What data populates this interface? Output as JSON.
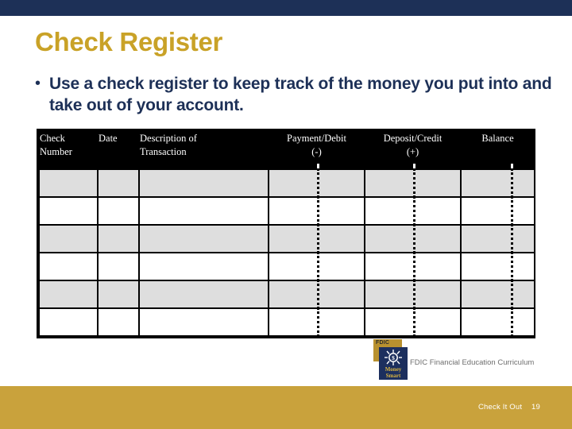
{
  "slide": {
    "title": "Check Register",
    "bullets": [
      {
        "marker": "•",
        "text": "Use a check register to keep track of the money you put into and take out of your account."
      }
    ]
  },
  "register": {
    "columns": [
      {
        "line1": "Check",
        "line2": "Number",
        "align": "left",
        "money": false
      },
      {
        "line1": "Date",
        "line2": "",
        "align": "left",
        "money": false
      },
      {
        "line1": "Description of",
        "line2": "Transaction",
        "align": "left",
        "money": false
      },
      {
        "line1": "Payment/Debit",
        "line2": "(-)",
        "align": "center",
        "money": true
      },
      {
        "line1": "Deposit/Credit",
        "line2": "(+)",
        "align": "center",
        "money": true
      },
      {
        "line1": "Balance",
        "line2": "",
        "align": "center",
        "money": true
      }
    ],
    "row_count": 6,
    "rows": [
      {
        "shaded": true,
        "cells": [
          "",
          "",
          "",
          "",
          "",
          ""
        ]
      },
      {
        "shaded": false,
        "cells": [
          "",
          "",
          "",
          "",
          "",
          ""
        ]
      },
      {
        "shaded": true,
        "cells": [
          "",
          "",
          "",
          "",
          "",
          ""
        ]
      },
      {
        "shaded": false,
        "cells": [
          "",
          "",
          "",
          "",
          "",
          ""
        ]
      },
      {
        "shaded": true,
        "cells": [
          "",
          "",
          "",
          "",
          "",
          ""
        ]
      },
      {
        "shaded": false,
        "cells": [
          "",
          "",
          "",
          "",
          "",
          ""
        ]
      }
    ]
  },
  "logo": {
    "fdic_tag": "FDIC",
    "money": "Money",
    "smart": "Smart",
    "caption": "FDIC Financial Education Curriculum",
    "sun_icon": "sun-icon"
  },
  "footer": {
    "label": "Check It Out",
    "page_number": "19"
  },
  "colors": {
    "navy": "#1d3057",
    "gold": "#c9a23c",
    "title_gold": "#c9a227",
    "header_black": "#000000",
    "row_shade": "#dedede",
    "caption_gray": "#6e6e6e"
  }
}
